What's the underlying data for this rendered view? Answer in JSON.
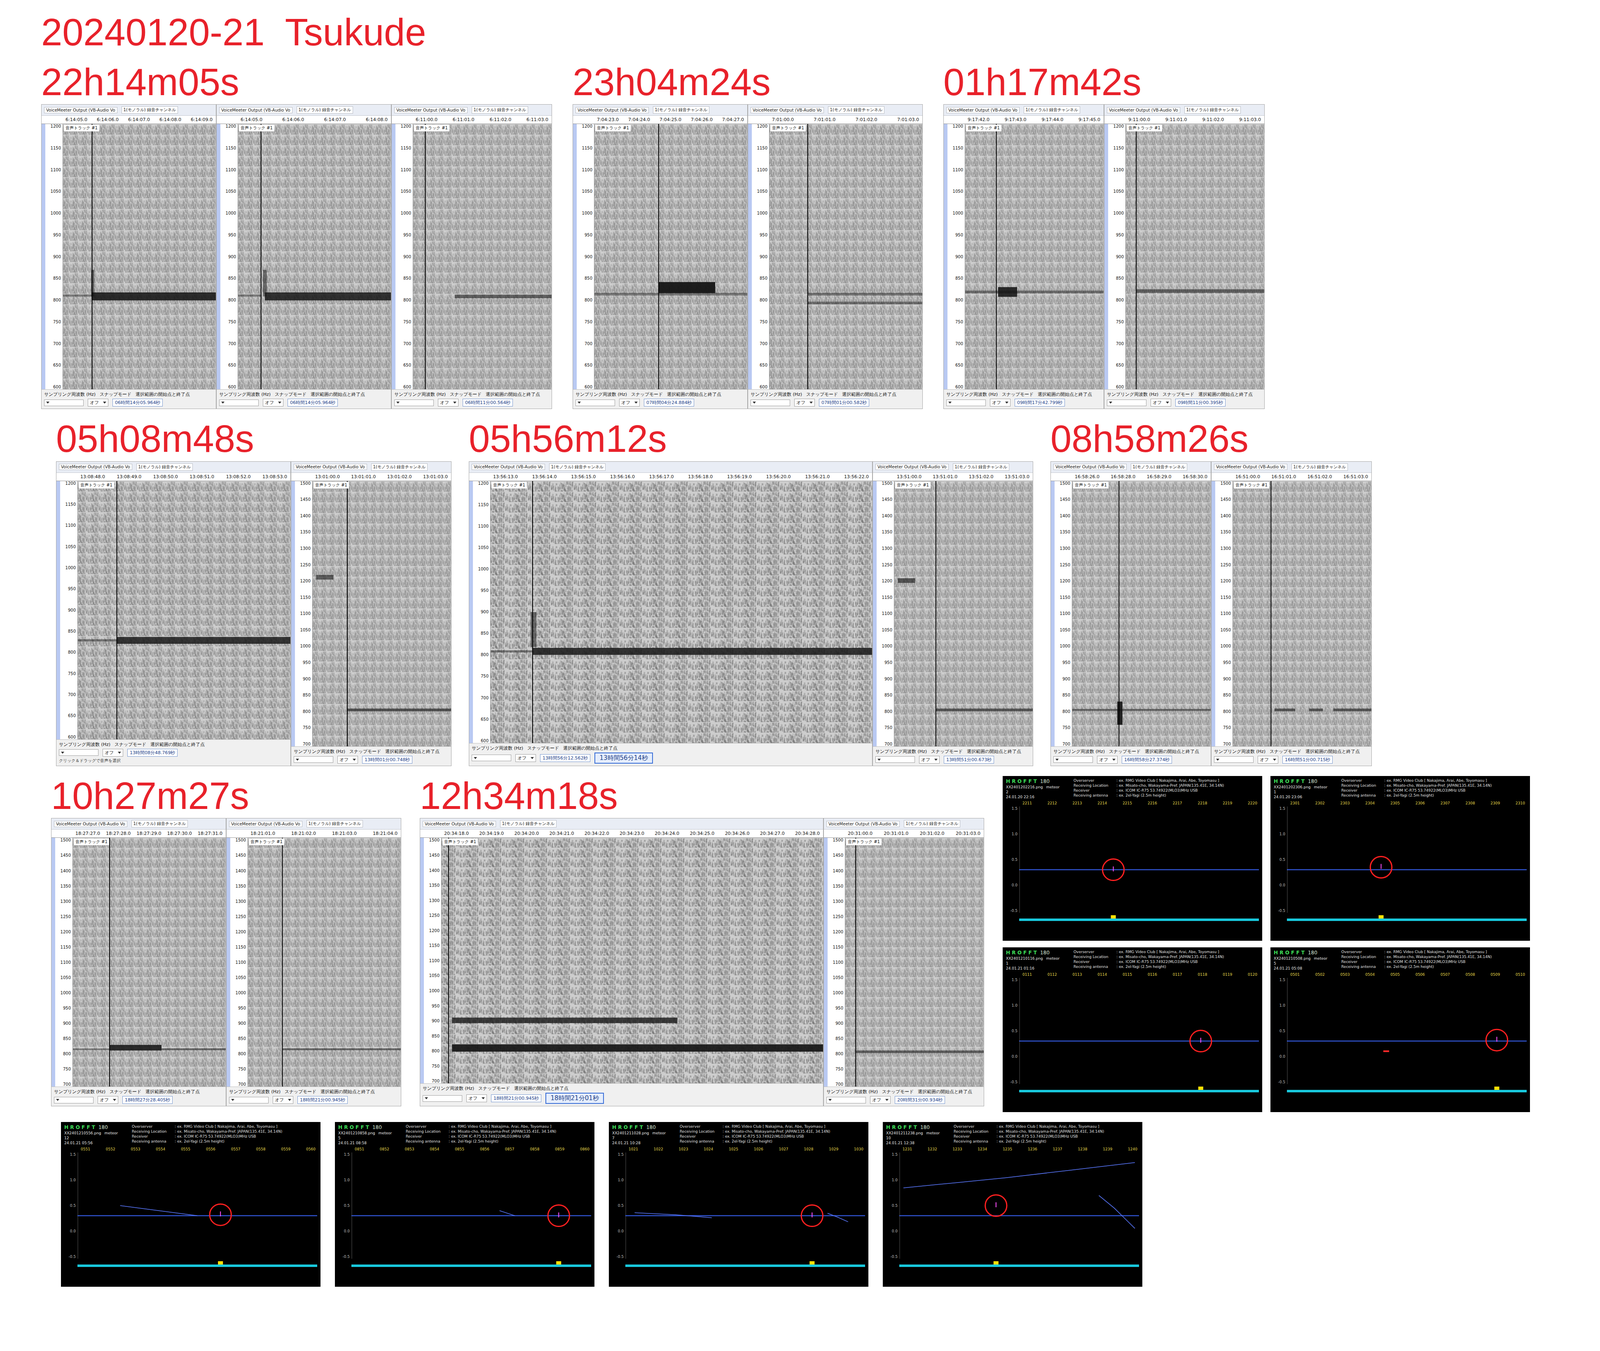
{
  "title": "20240120-21  Tsukude",
  "ui": {
    "track": "音声トラック #1",
    "device": "VoiceMeeter Output (VB-Audio Vo",
    "channel": "1(モノラル) 録音チャンネル",
    "rate": "サンプリング周波数 (Hz)",
    "snap": "スナップモード",
    "range": "選択範囲の開始点と終了点",
    "snap_value": "オフ"
  },
  "axes": {
    "low": [
      "1200",
      "1150",
      "1100",
      "1050",
      "1000",
      "950",
      "900",
      "850",
      "800",
      "750",
      "700",
      "650",
      "600"
    ],
    "high": [
      "1500",
      "1450",
      "1400",
      "1350",
      "1300",
      "1250",
      "1200",
      "1150",
      "1100",
      "1050",
      "1000",
      "950",
      "900",
      "850",
      "800",
      "750",
      "700"
    ]
  },
  "groups": [
    {
      "label": "22h14m05s",
      "shots": [
        {
          "size": "m",
          "axis": "low",
          "ruler": [
            "6:14:05.0",
            "6:14:06.0",
            "6:14:07.0",
            "6:14:08.0",
            "6:14:09.0"
          ],
          "duration": 5,
          "cursor": 0.95,
          "traces": [
            {
              "t0": 0.95,
              "t1": 5,
              "hz": 810,
              "bw": 18,
              "strength": 0.9
            },
            {
              "t0": 0,
              "t1": 0.95,
              "hz": 812,
              "bw": 5,
              "strength": 0.25
            },
            {
              "t0": 0.92,
              "t1": 1.02,
              "hz": 840,
              "bw": 60,
              "strength": 0.4
            }
          ],
          "time": "06時間14分05.964秒"
        },
        {
          "size": "m",
          "axis": "low",
          "ruler": [
            "6:14:05.0",
            "6:14:06.0",
            "6:14:07.0",
            "6:14:08.0"
          ],
          "duration": 4,
          "cursor": 0.6,
          "traces": [
            {
              "t0": 0.7,
              "t1": 4,
              "hz": 810,
              "bw": 18,
              "strength": 0.85
            },
            {
              "t0": 0,
              "t1": 0.6,
              "hz": 812,
              "bw": 5,
              "strength": 0.25
            },
            {
              "t0": 0.65,
              "t1": 0.75,
              "hz": 840,
              "bw": 60,
              "strength": 0.4
            }
          ],
          "time": "06時間14分05.964秒"
        },
        {
          "size": "s",
          "axis": "low",
          "ruler": [
            "6:11:00.0",
            "6:11:01.0",
            "6:11:02.0",
            "6:11:03.0"
          ],
          "duration": 4,
          "cursor": 0.35,
          "traces": [
            {
              "t0": 1.2,
              "t1": 4,
              "hz": 810,
              "bw": 8,
              "strength": 0.45
            }
          ],
          "time": "06時間11分00.564秒"
        }
      ]
    },
    {
      "label": "23h04m24s",
      "shots": [
        {
          "size": "m",
          "axis": "low",
          "ruler": [
            "7:04:23.0",
            "7:04:24.0",
            "7:04:25.0",
            "7:04:26.0",
            "7:04:27.0"
          ],
          "duration": 5,
          "cursor": 2.1,
          "traces": [
            {
              "t0": 0,
              "t1": 5,
              "hz": 815,
              "bw": 6,
              "strength": 0.3
            },
            {
              "t0": 2.1,
              "t1": 3.95,
              "hz": 830,
              "bw": 25,
              "strength": 1
            }
          ],
          "time": "07時間04分24.884秒"
        },
        {
          "size": "m",
          "axis": "low",
          "ruler": [
            "7:01:00.0",
            "7:01:01.0",
            "7:01:02.0",
            "7:01:03.0"
          ],
          "duration": 4,
          "cursor": 1.0,
          "traces": [
            {
              "t0": 1,
              "t1": 4,
              "hz": 815,
              "bw": 6,
              "strength": 0.35
            },
            {
              "t0": 1,
              "t1": 4,
              "hz": 795,
              "bw": 6,
              "strength": 0.3
            }
          ],
          "time": "07時間01分00.582秒"
        }
      ]
    },
    {
      "label": "01h17m42s",
      "shots": [
        {
          "size": "s",
          "axis": "low",
          "ruler": [
            "9:17:42.0",
            "9:17:43.0",
            "9:17:44.0",
            "9:17:45.0"
          ],
          "duration": 4,
          "cursor": 0.9,
          "traces": [
            {
              "t0": 0,
              "t1": 4,
              "hz": 820,
              "bw": 6,
              "strength": 0.3
            },
            {
              "t0": 0.95,
              "t1": 1.5,
              "hz": 820,
              "bw": 22,
              "strength": 0.9
            }
          ],
          "time": "09時間17分42.799秒"
        },
        {
          "size": "s",
          "axis": "low",
          "ruler": [
            "9:11:00.0",
            "9:11:01.0",
            "9:11:02.0",
            "9:11:03.0"
          ],
          "duration": 4,
          "cursor": 0.3,
          "traces": [
            {
              "t0": 0.3,
              "t1": 4,
              "hz": 822,
              "bw": 8,
              "strength": 0.4
            }
          ],
          "time": "09時間11分00.395秒"
        }
      ]
    },
    {
      "label": "05h08m48s",
      "shots": [
        {
          "size": "l",
          "axis": "low",
          "ruler": [
            "13:08:48.0",
            "13:08:49.0",
            "13:08:50.0",
            "13:08:51.0",
            "13:08:52.0",
            "13:08:53.0"
          ],
          "duration": 6,
          "cursor": 1.1,
          "traces": [
            {
              "t0": 1.1,
              "t1": 6,
              "hz": 830,
              "bw": 16,
              "strength": 0.8
            },
            {
              "t0": 0,
              "t1": 1.1,
              "hz": 830,
              "bw": 5,
              "strength": 0.3
            }
          ],
          "time": "13時間08分48.769秒",
          "note": "クリック＆ドラッグで音声を選択"
        },
        {
          "size": "s",
          "axis": "high",
          "ruler": [
            "13:01:00.0",
            "13:01:01.0",
            "13:01:02.0",
            "13:01:03.0"
          ],
          "duration": 4,
          "cursor": 1.0,
          "traces": [
            {
              "t0": 0.1,
              "t1": 0.6,
              "hz": 1210,
              "bw": 14,
              "strength": 0.5
            },
            {
              "t0": 1,
              "t1": 4,
              "hz": 810,
              "bw": 8,
              "strength": 0.55
            }
          ],
          "time": "13時間01分00.748秒"
        }
      ]
    },
    {
      "label": "05h56m12s",
      "shots": [
        {
          "size": "xl",
          "axis": "low",
          "ruler": [
            "13:56:13.0",
            "13:56:14.0",
            "13:56:15.0",
            "13:56:16.0",
            "13:56:17.0",
            "13:56:18.0",
            "13:56:19.0",
            "13:56:20.0",
            "13:56:21.0",
            "13:56:22.0"
          ],
          "duration": 10,
          "cursor": 1.1,
          "traces": [
            {
              "t0": 1.1,
              "t1": 10,
              "hz": 810,
              "bw": 16,
              "strength": 0.85
            },
            {
              "t0": 0,
              "t1": 1.1,
              "hz": 810,
              "bw": 5,
              "strength": 0.3
            },
            {
              "t0": 1.05,
              "t1": 1.2,
              "hz": 860,
              "bw": 80,
              "strength": 0.4
            }
          ],
          "time": "13時間56分12.562秒",
          "badge": "13時間56分14秒"
        },
        {
          "size": "s",
          "axis": "high",
          "ruler": [
            "13:51:00.0",
            "13:51:01.0",
            "13:51:02.0",
            "13:51:03.0"
          ],
          "duration": 4,
          "cursor": 1.2,
          "traces": [
            {
              "t0": 0.1,
              "t1": 0.6,
              "hz": 1200,
              "bw": 14,
              "strength": 0.55
            },
            {
              "t0": 1.2,
              "t1": 4,
              "hz": 810,
              "bw": 8,
              "strength": 0.5
            }
          ],
          "time": "13時間51分00.673秒"
        }
      ]
    },
    {
      "label": "08h58m26s",
      "shots": [
        {
          "size": "s",
          "axis": "high",
          "ruler": [
            "16:58:26.0",
            "16:58:28.0",
            "16:58:29.0",
            "16:58:30.0"
          ],
          "duration": 4,
          "cursor": 1.35,
          "traces": [
            {
              "t0": 0,
              "t1": 4,
              "hz": 810,
              "bw": 6,
              "strength": 0.35
            },
            {
              "t0": 1.3,
              "t1": 1.45,
              "hz": 800,
              "bw": 70,
              "strength": 0.95
            }
          ],
          "time": "16時間58分27.374秒"
        },
        {
          "size": "s",
          "axis": "high",
          "ruler": [
            "16:51:00.0",
            "16:51:01.0",
            "16:51:02.0",
            "16:51:03.0"
          ],
          "duration": 4,
          "cursor": 1.1,
          "traces": [
            {
              "t0": 1.2,
              "t1": 1.8,
              "hz": 810,
              "bw": 8,
              "strength": 0.5
            },
            {
              "t0": 2.2,
              "t1": 2.6,
              "hz": 810,
              "bw": 8,
              "strength": 0.5
            },
            {
              "t0": 2.9,
              "t1": 4,
              "hz": 810,
              "bw": 8,
              "strength": 0.5
            }
          ],
          "time": "16時間51分00.715秒"
        }
      ]
    },
    {
      "label": "10h27m27s",
      "shots": [
        {
          "size": "m",
          "axis": "high",
          "ruler": [
            "18:27:27.0",
            "18:27:28.0",
            "18:27:29.0",
            "18:27:30.0",
            "18:27:31.0"
          ],
          "duration": 5,
          "cursor": 1.2,
          "traces": [
            {
              "t0": 1.2,
              "t1": 2.9,
              "hz": 825,
              "bw": 18,
              "strength": 0.9
            },
            {
              "t0": 2.9,
              "t1": 5,
              "hz": 820,
              "bw": 6,
              "strength": 0.4
            },
            {
              "t0": 0,
              "t1": 1.2,
              "hz": 820,
              "bw": 5,
              "strength": 0.25
            }
          ],
          "time": "18時間27分28.405秒"
        },
        {
          "size": "m",
          "axis": "high",
          "ruler": [
            "18:21:01.0",
            "18:21:02.0",
            "18:21:03.0",
            "18:21:04.0"
          ],
          "duration": 4,
          "cursor": 0.9,
          "traces": [
            {
              "t0": 0.9,
              "t1": 4,
              "hz": 820,
              "bw": 6,
              "strength": 0.4
            }
          ],
          "time": "18時間21分00.945秒"
        }
      ]
    },
    {
      "label": "12h34m18s",
      "shots": [
        {
          "size": "xl",
          "axis": "high",
          "ruler": [
            "20:34:18.0",
            "20:34:19.0",
            "20:34:20.0",
            "20:34:21.0",
            "20:34:22.0",
            "20:34:23.0",
            "20:34:24.0",
            "20:34:25.0",
            "20:34:26.0",
            "20:34:27.0",
            "20:34:28.0"
          ],
          "duration": 11,
          "cursor": 0.2,
          "traces": [
            {
              "t0": 0.3,
              "t1": 6.8,
              "hz": 905,
              "bw": 18,
              "strength": 0.75
            },
            {
              "t0": 0.3,
              "t1": 11,
              "hz": 815,
              "bw": 24,
              "strength": 0.95
            }
          ],
          "time": "18時間21分00.945秒",
          "badge": "18時間21分01秒"
        },
        {
          "size": "s",
          "axis": "high",
          "ruler": [
            "20:31:00.0",
            "20:31:01.0",
            "20:31:02.0",
            "20:31:03.0"
          ],
          "duration": 4,
          "cursor": 0.3,
          "traces": [
            {
              "t0": 0.3,
              "t1": 4,
              "hz": 812,
              "bw": 8,
              "strength": 0.45
            }
          ],
          "time": "20時間31分00.934秒"
        }
      ]
    }
  ],
  "hrofft_common": {
    "logo": "H R O F F T",
    "version": "180",
    "meteor_label": "meteor",
    "info": [
      {
        "key": "Overserver",
        "value": ": ex. RMG Video Club [ Nakajima, Arai, Abe, Toyomasu ]"
      },
      {
        "key": "Receiving Location",
        "value": ": ex. Misato-cho, Wakayama-Pref. JAPAN(135.41E, 34.14N)"
      },
      {
        "key": "Receiver",
        "value": ": ex. ICOM IC-R75 53.74922(MLO3)MHz USB"
      },
      {
        "key": "Receiving antenna",
        "value": ": ex. 2el-Yagi (2.5m height)"
      }
    ],
    "yticks": [
      "1.5",
      "1.0",
      "0.5",
      "0.0",
      "-0.5"
    ],
    "carrier": 0.3
  },
  "hrofft": [
    {
      "file": "XX2401202216.png",
      "count": "2",
      "date": "24.01.20 22:16",
      "xticks": [
        "2211",
        "2212",
        "2213",
        "2214",
        "2215",
        "2216",
        "2217",
        "2218",
        "2219",
        "2220"
      ],
      "marker": [
        2214.5,
        0.3
      ],
      "curves": [],
      "red_marks": []
    },
    {
      "file": "XX2401202306.png",
      "count": "1",
      "date": "24.01.20 23:06",
      "xticks": [
        "2301",
        "2302",
        "2303",
        "2304",
        "2305",
        "2306",
        "2307",
        "2308",
        "2309",
        "2310"
      ],
      "marker": [
        2304.5,
        0.35
      ],
      "curves": [],
      "red_marks": []
    },
    {
      "file": "XX2401210116.png",
      "count": "1",
      "date": "24.01.21 01:16",
      "xticks": [
        "0111",
        "0112",
        "0113",
        "0114",
        "0115",
        "0116",
        "0117",
        "0118",
        "0119",
        "0120"
      ],
      "marker": [
        117.9,
        0.3
      ],
      "curves": [],
      "red_marks": []
    },
    {
      "file": "XX2401210508.png",
      "count": "5",
      "date": "24.01.21 05:08",
      "xticks": [
        "0501",
        "0502",
        "0503",
        "0504",
        "0505",
        "0506",
        "0507",
        "0508",
        "0509",
        "0510"
      ],
      "marker": [
        509.0,
        0.32
      ],
      "curves": [],
      "red_marks": [
        [
          504.7,
          0.1
        ]
      ]
    },
    {
      "file": "XX2401210556.png",
      "count": "12",
      "date": "24.01.21 05:56",
      "xticks": [
        "0551",
        "0552",
        "0553",
        "0554",
        "0555",
        "0556",
        "0557",
        "0558",
        "0559",
        "0560"
      ],
      "marker": [
        556.4,
        0.32
      ],
      "curves": [
        [
          [
            552.5,
            0.5
          ],
          [
            554.0,
            0.4
          ],
          [
            555.5,
            0.3
          ]
        ]
      ],
      "red_marks": []
    },
    {
      "file": "XX2401210858.png",
      "count": "5",
      "date": "24.01.21 08:58",
      "xticks": [
        "0851",
        "0852",
        "0853",
        "0854",
        "0855",
        "0856",
        "0857",
        "0858",
        "0859",
        "0860"
      ],
      "marker": [
        858.9,
        0.3
      ],
      "curves": [
        [
          [
            856.6,
            0.4
          ],
          [
            857.2,
            0.3
          ]
        ]
      ],
      "red_marks": []
    },
    {
      "file": "XX2401211028.png",
      "count": "7",
      "date": "24.01.21 10:28",
      "xticks": [
        "1021",
        "1022",
        "1023",
        "1024",
        "1025",
        "1026",
        "1027",
        "1028",
        "1029",
        "1030"
      ],
      "marker": [
        1028.1,
        0.3
      ],
      "curves": [
        [
          [
            1021.2,
            0.36
          ],
          [
            1022.8,
            0.32
          ],
          [
            1024.2,
            0.26
          ]
        ],
        [
          [
            1028.7,
            0.35
          ],
          [
            1029.1,
            0.27
          ],
          [
            1029.5,
            0.18
          ]
        ]
      ],
      "red_marks": []
    },
    {
      "file": "XX2401211238.png",
      "count": "10",
      "date": "24.01.21 12:38",
      "xticks": [
        "1231",
        "1232",
        "1233",
        "1234",
        "1235",
        "1236",
        "1237",
        "1238",
        "1239",
        "1240"
      ],
      "marker": [
        1234.6,
        0.5
      ],
      "curves": [
        [
          [
            1231,
            0.85
          ],
          [
            1233,
            0.95
          ],
          [
            1235,
            1.05
          ],
          [
            1237.5,
            1.2
          ],
          [
            1240,
            1.35
          ]
        ],
        [
          [
            1238.6,
            0.7
          ],
          [
            1239.2,
            0.45
          ],
          [
            1239.6,
            0.25
          ],
          [
            1240,
            0.05
          ]
        ]
      ],
      "red_marks": []
    }
  ]
}
